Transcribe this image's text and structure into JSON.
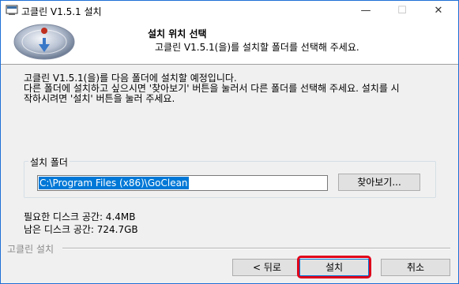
{
  "window": {
    "title": "고클린 V1.5.1 설치",
    "controls": {
      "minimize": "—",
      "maximize": "☐",
      "close": "✕"
    }
  },
  "header": {
    "title": "설치 위치 선택",
    "subtitle": "고클린 V1.5.1(을)를 설치할 폴더를 선택해 주세요."
  },
  "description": {
    "line1": "고클린 V1.5.1(을)를 다음 폴더에 설치할 예정입니다.",
    "line2": "다른 폴더에 설치하고 싶으시면 '찾아보기' 버튼을 눌러서 다른 폴더를 선택해 주세요. 설치를 시",
    "line3": "작하시려면 '설치' 버튼을 눌러 주세요."
  },
  "install_folder": {
    "label": "설치 폴더",
    "path": "C:\\Program Files (x86)\\GoClean",
    "browse_label": "찾아보기..."
  },
  "space": {
    "required": "필요한 디스크 공간: 4.4MB",
    "available": "남은 디스크 공간: 724.7GB"
  },
  "footer": {
    "brand": "고클린 설치",
    "back_label": "< 뒤로",
    "install_label": "설치",
    "cancel_label": "취소"
  },
  "colors": {
    "accent": "#0078d7",
    "highlight": "#e0001a",
    "window_bg": "#f0f0f0"
  },
  "icons": [
    "installer-app-icon",
    "header-logo-icon"
  ]
}
